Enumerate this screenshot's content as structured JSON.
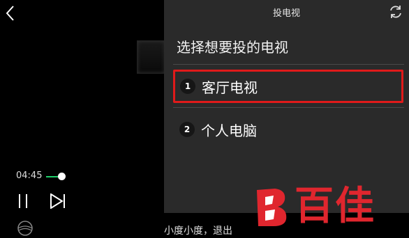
{
  "player": {
    "time": "04:45",
    "progress_fraction": 0.2,
    "accent": "#1fcf6a"
  },
  "panel": {
    "title": "投电视",
    "heading": "选择想要投的电视",
    "devices": [
      {
        "index": "1",
        "label": "客厅电视",
        "selected": true
      },
      {
        "index": "2",
        "label": "个人电脑",
        "selected": false
      }
    ],
    "highlight_color": "#e01a1a"
  },
  "voice_hint": "小度小度，退出",
  "watermark": {
    "text": "百佳",
    "color": "#e0262e"
  },
  "icons": {
    "back": "chevron-left-icon",
    "pause": "pause-icon",
    "next": "skip-next-icon",
    "globe": "globe-icon",
    "refresh": "refresh-icon"
  }
}
